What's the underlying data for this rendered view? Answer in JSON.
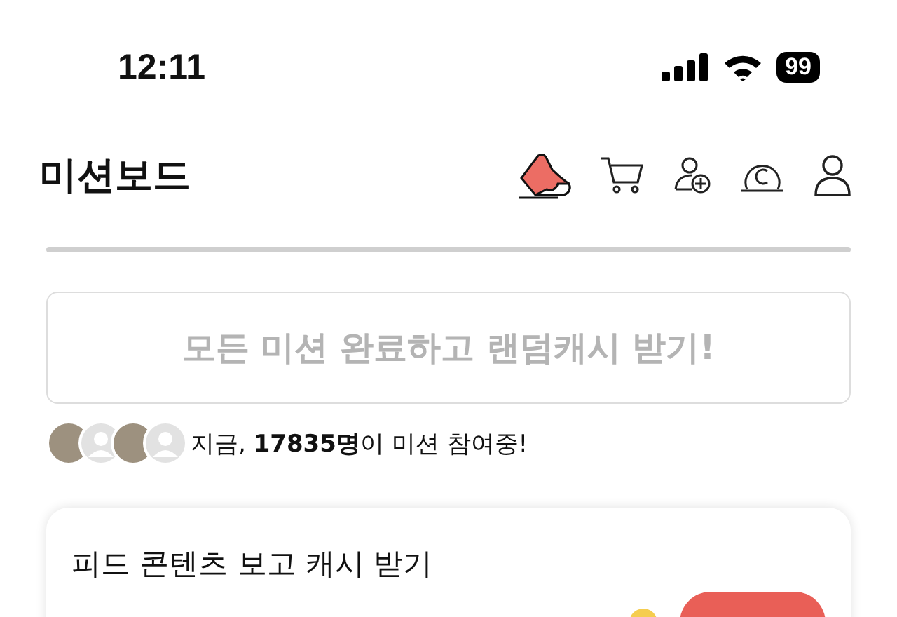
{
  "status_bar": {
    "time": "12:11",
    "battery": "99"
  },
  "header": {
    "title": "미션보드"
  },
  "all_missions_button": {
    "label": "모든 미션 완료하고 랜덤캐시 받기!",
    "disabled": true
  },
  "participants": {
    "avatars": [
      {
        "kind": "photo"
      },
      {
        "kind": "generic"
      },
      {
        "kind": "photo"
      },
      {
        "kind": "generic"
      }
    ],
    "text": "지금, **17835명**이 미션 참여중!"
  },
  "mission_card": {
    "title": "피드 콘텐츠 보고 캐시 받기"
  }
}
